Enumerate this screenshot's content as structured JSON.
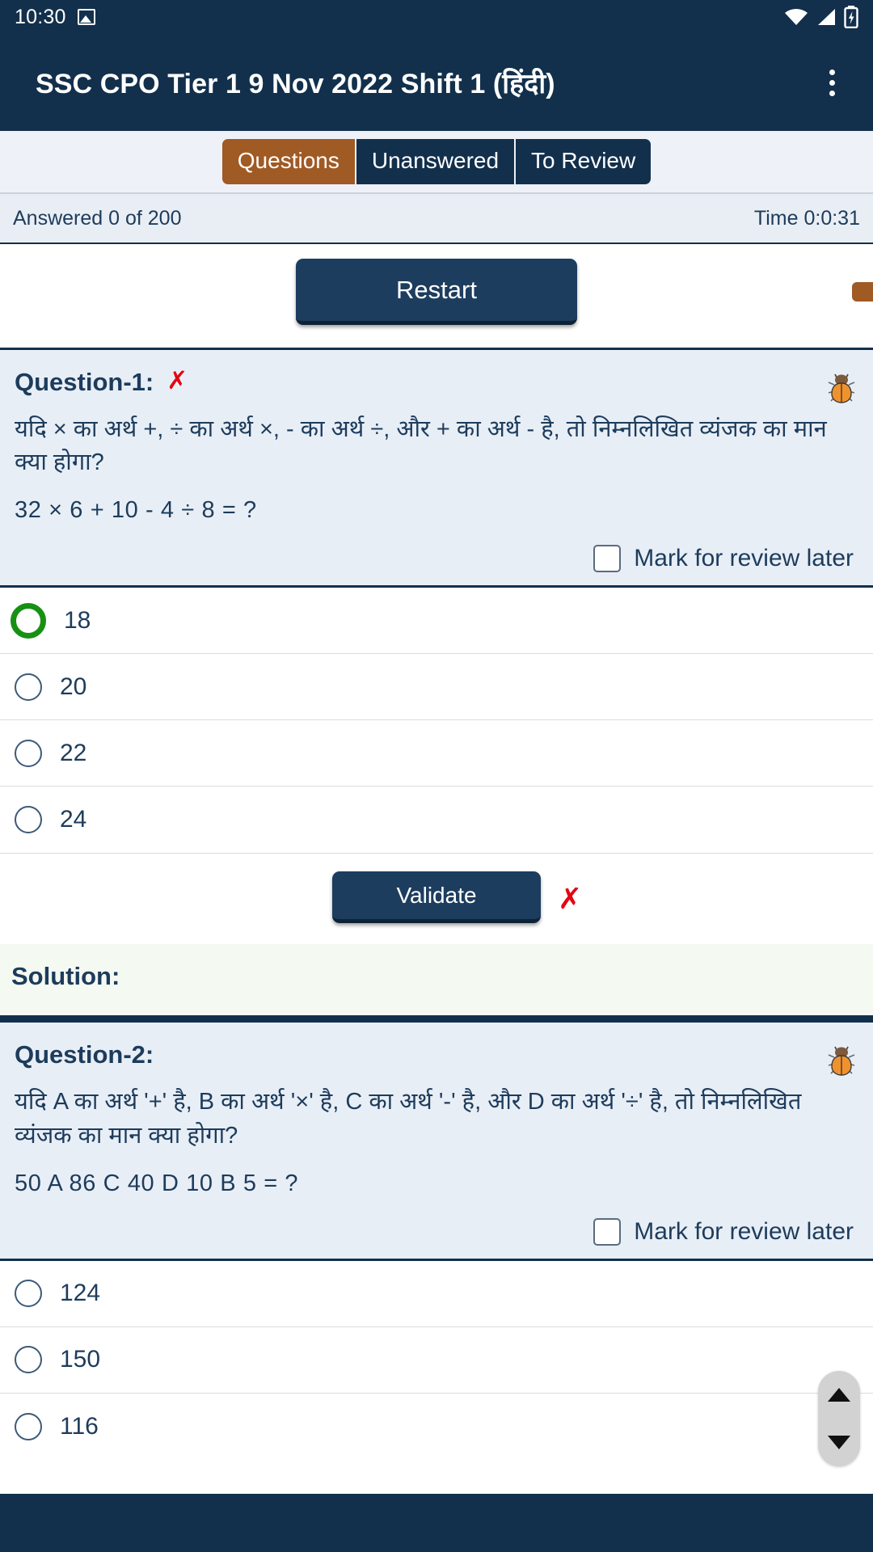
{
  "status_bar": {
    "time": "10:30",
    "icons": [
      "image-icon",
      "wifi-icon",
      "signal-icon",
      "battery-charging-icon"
    ]
  },
  "app_bar": {
    "title": "SSC CPO Tier 1 9 Nov 2022 Shift 1 (हिंदी)",
    "menu_icon": "kebab-menu-icon"
  },
  "tabs": [
    {
      "label": "Questions",
      "active": true
    },
    {
      "label": "Unanswered",
      "active": false
    },
    {
      "label": "To Review",
      "active": false
    }
  ],
  "meta": {
    "answered": "Answered 0 of 200",
    "time": "Time 0:0:31"
  },
  "toolbar": {
    "restart_label": "Restart"
  },
  "common": {
    "mark_label": "Mark for review later",
    "validate_label": "Validate",
    "solution_label": "Solution:",
    "wrong_mark": "✗",
    "bug_icon": "bug-icon"
  },
  "colors": {
    "app_bar": "#12304c",
    "accent_orange": "#a05a24",
    "question_bg": "#e8eef6",
    "solution_bg": "#f4f9f2",
    "correct_green": "#179113",
    "wrong_red": "#e30613",
    "text_navy": "#1d3c5c"
  },
  "questions": [
    {
      "label": "Question-1:",
      "result_mark": "✗",
      "text": "यदि × का अर्थ +, ÷ का अर्थ ×, - का अर्थ ÷, और + का अर्थ - है, तो निम्नलिखित व्यंजक का मान क्या होगा?",
      "expression": "32 × 6 + 10 - 4 ÷ 8 = ?",
      "marked_for_review": false,
      "options": [
        {
          "label": "18",
          "state": "correct"
        },
        {
          "label": "20",
          "state": "none"
        },
        {
          "label": "22",
          "state": "none"
        },
        {
          "label": "24",
          "state": "none"
        }
      ],
      "validated": true,
      "validate_result": "✗",
      "solution_text": ""
    },
    {
      "label": "Question-2:",
      "result_mark": "",
      "text": "यदि A का अर्थ '+' है, B का अर्थ '×' है, C का अर्थ '-' है, और D का अर्थ '÷' है, तो निम्नलिखित व्यंजक का मान क्या होगा?",
      "expression": "50 A 86 C 40 D 10 B 5 = ?",
      "marked_for_review": false,
      "options": [
        {
          "label": "124",
          "state": "none"
        },
        {
          "label": "150",
          "state": "none"
        },
        {
          "label": "116",
          "state": "none"
        }
      ]
    }
  ],
  "scroll_nub": {
    "up_icon": "scroll-up-icon",
    "down_icon": "scroll-down-icon"
  }
}
